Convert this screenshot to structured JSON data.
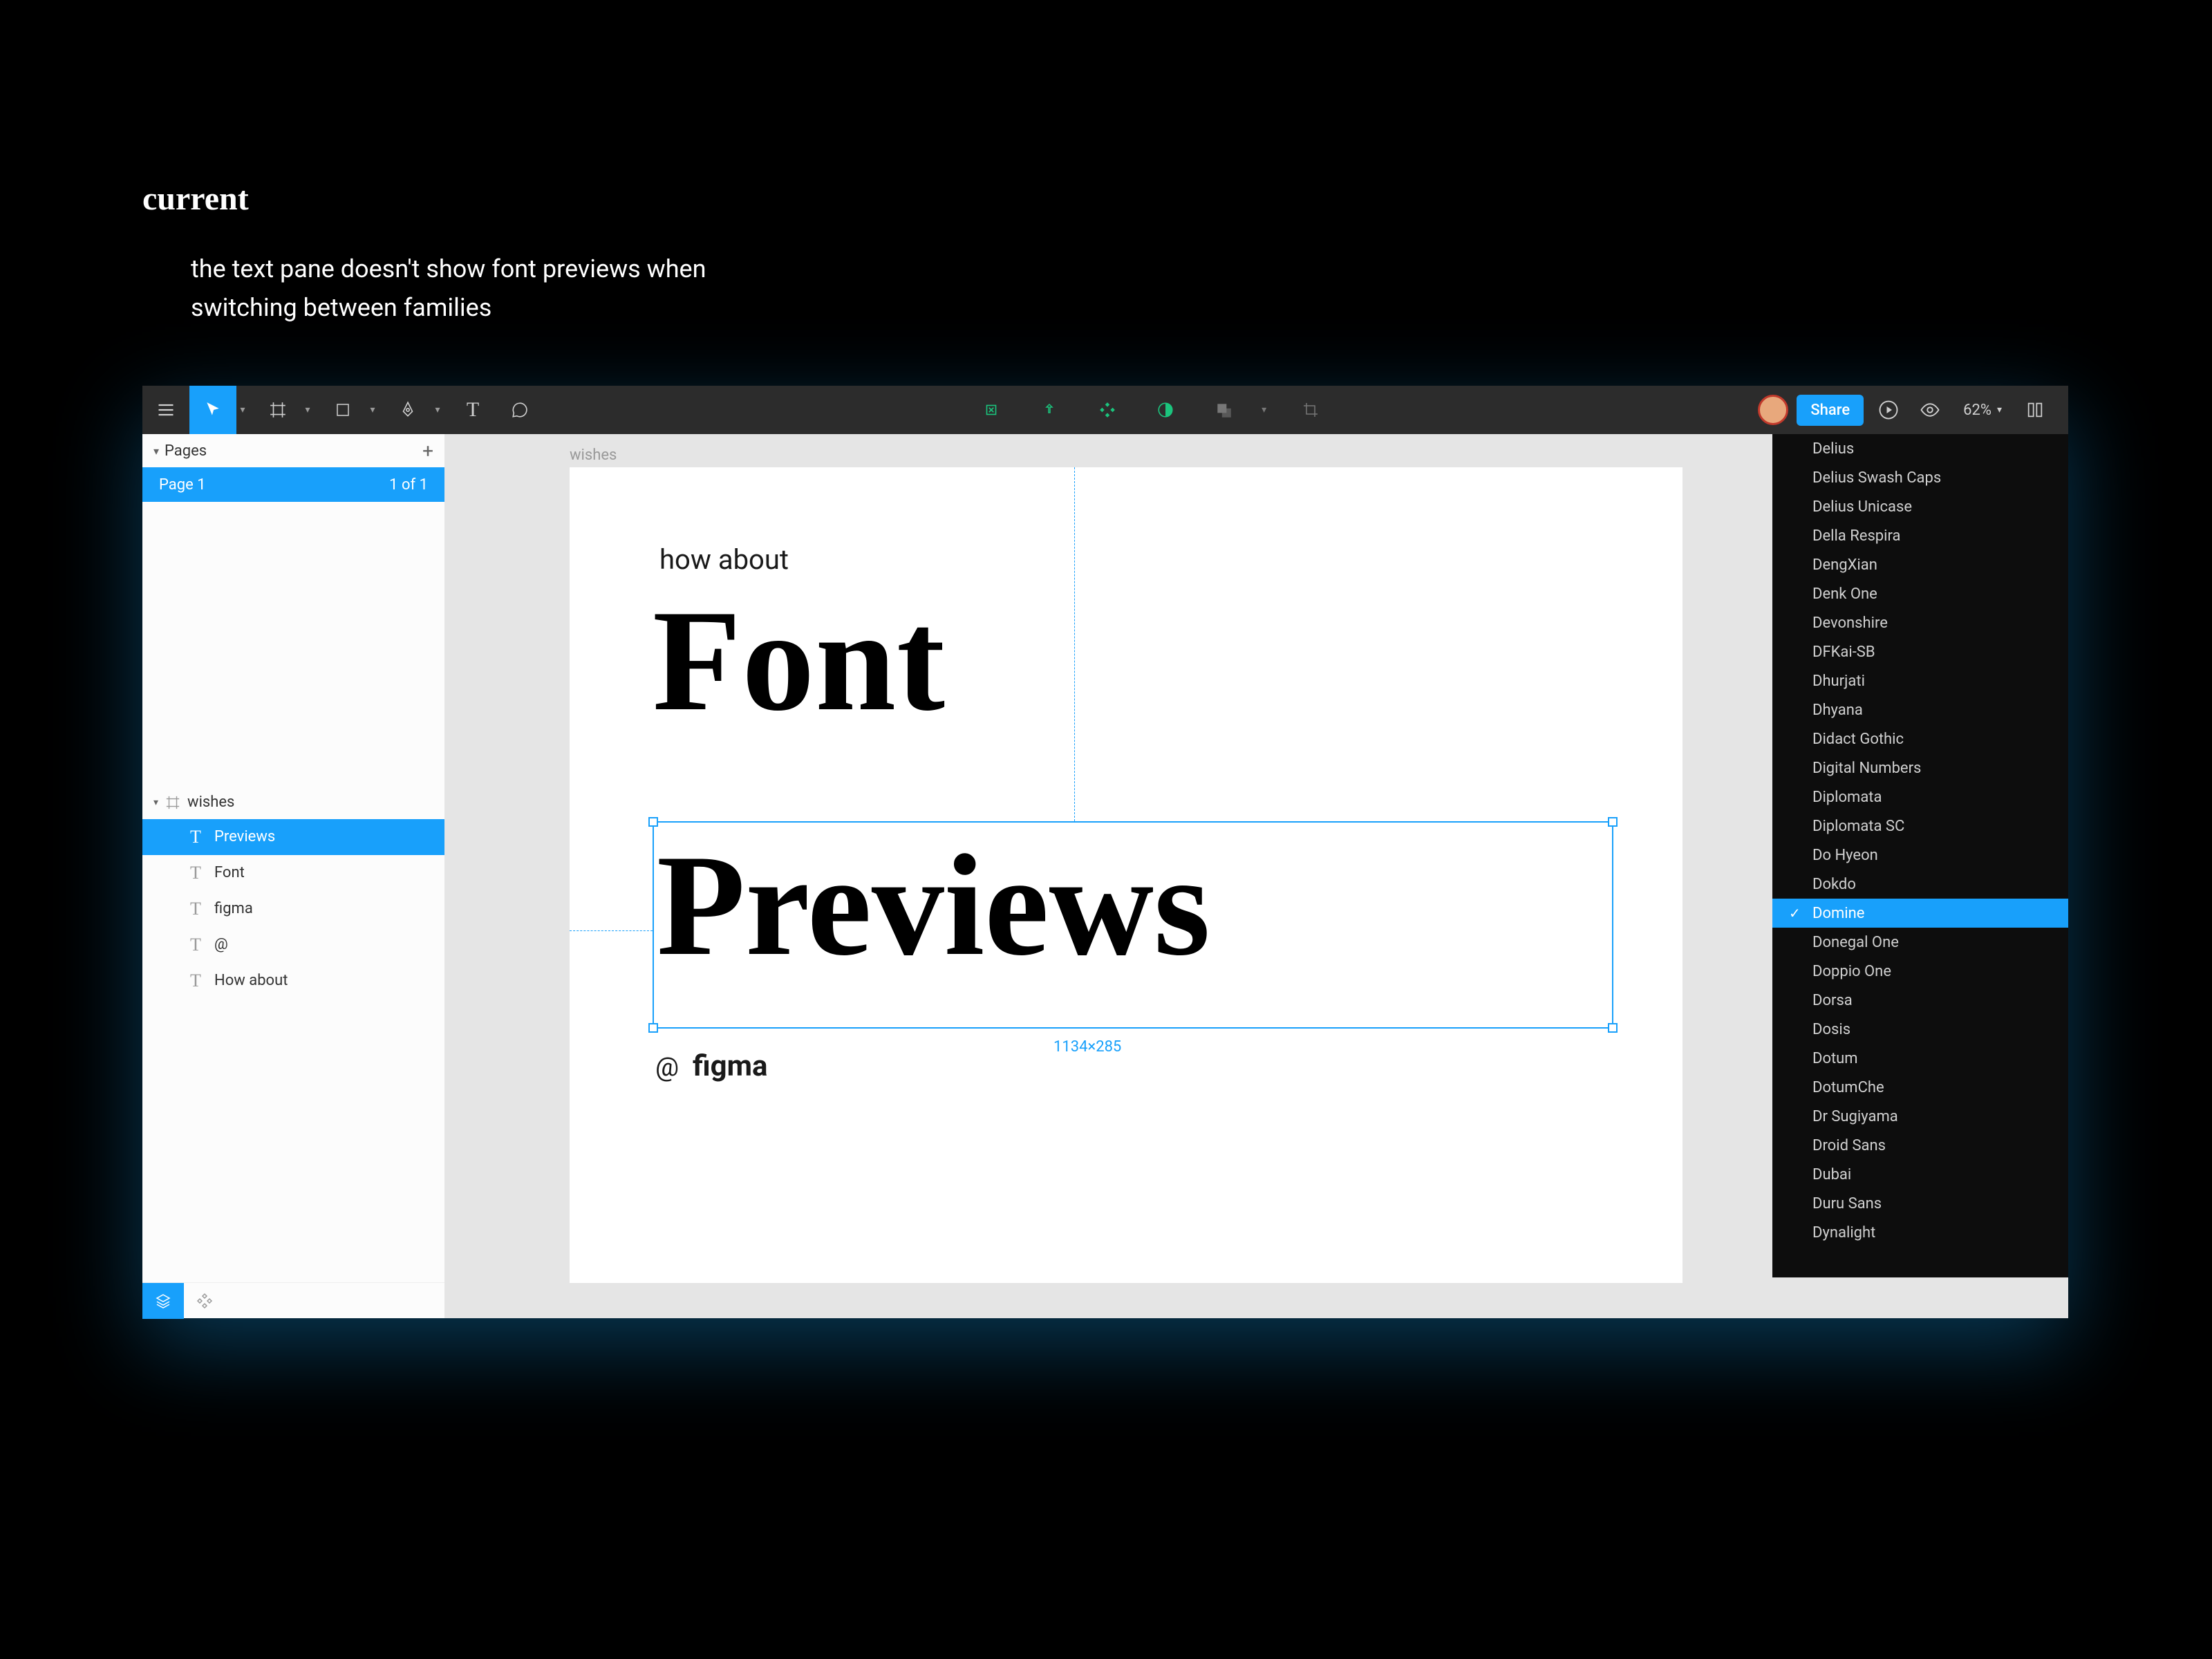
{
  "slide": {
    "title": "current",
    "caption_line1": "the text pane doesn't show font previews when",
    "caption_line2": "switching between families"
  },
  "toolbar": {
    "share_label": "Share",
    "zoom": "62%"
  },
  "pages": {
    "section_label": "Pages",
    "items": [
      {
        "name": "Page 1",
        "badge": "1 of 1"
      }
    ]
  },
  "layers": {
    "root": "wishes",
    "items": [
      {
        "label": "Previews",
        "selected": true
      },
      {
        "label": "Font",
        "selected": false
      },
      {
        "label": "figma",
        "selected": false
      },
      {
        "label": "@",
        "selected": false
      },
      {
        "label": "How about",
        "selected": false
      }
    ]
  },
  "canvas": {
    "frame_label": "wishes",
    "text_howabout": "how about",
    "text_font": "Font",
    "text_previews": "Previews",
    "text_at": "@",
    "text_figma": "figma",
    "selection_dims": "1134×285"
  },
  "font_list": {
    "selected": "Domine",
    "items": [
      "Delius",
      "Delius Swash Caps",
      "Delius Unicase",
      "Della Respira",
      "DengXian",
      "Denk One",
      "Devonshire",
      "DFKai-SB",
      "Dhurjati",
      "Dhyana",
      "Didact Gothic",
      "Digital Numbers",
      "Diplomata",
      "Diplomata SC",
      "Do Hyeon",
      "Dokdo",
      "Domine",
      "Donegal One",
      "Doppio One",
      "Dorsa",
      "Dosis",
      "Dotum",
      "DotumChe",
      "Dr Sugiyama",
      "Droid Sans",
      "Dubai",
      "Duru Sans",
      "Dynalight"
    ]
  }
}
